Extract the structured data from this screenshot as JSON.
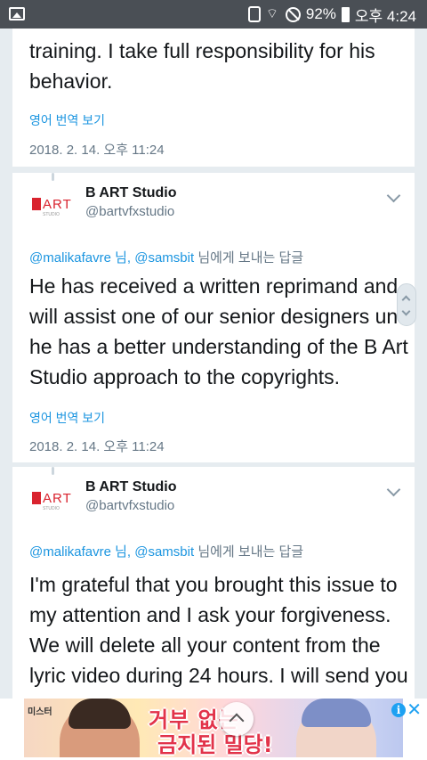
{
  "status_bar": {
    "battery": "92%",
    "time": "오후 4:24"
  },
  "tweets": [
    {
      "text_lines": [
        "training. I take full responsibility for his",
        "behavior."
      ],
      "translate_label": "영어 번역 보기",
      "timestamp": "2018. 2. 14. 오후 11:24"
    },
    {
      "name": "B ART Studio",
      "handle": "@bartvfxstudio",
      "reply": {
        "mention1": "@malikafavre",
        "sep1": " 님, ",
        "mention2": "@samsbit",
        "suffix": " 님에게 보내는 답글"
      },
      "text_lines": [
        "He has received a written reprimand and",
        "will assist one of our senior designers until",
        "he has a better understanding of the B Art",
        "Studio approach to the copyrights."
      ],
      "translate_label": "영어 번역 보기",
      "timestamp": "2018. 2. 14. 오후 11:24"
    },
    {
      "name": "B ART Studio",
      "handle": "@bartvfxstudio",
      "reply": {
        "mention1": "@malikafavre",
        "sep1": " 님, ",
        "mention2": "@samsbit",
        "suffix": " 님에게 보내는 답글"
      },
      "text_lines": [
        "I'm grateful that you brought this issue to",
        "my attention and I ask your forgiveness.",
        "We will delete all your content from the",
        "lyric video during 24 hours. I will send you"
      ]
    }
  ],
  "ad": {
    "brand": "미스터",
    "line1": "거부     없는",
    "line2": "금지된 밀당!",
    "info_label": "i",
    "close_label": "✕"
  },
  "colors": {
    "link": "#1b95e0",
    "secondary_text": "#657786",
    "background": "#e6ecf0",
    "status_bar": "#4a4f55",
    "ad_headline": "#e2334a"
  }
}
